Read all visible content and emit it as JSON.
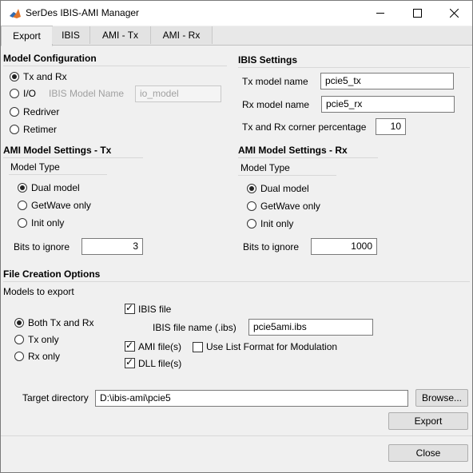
{
  "window": {
    "title": "SerDes IBIS-AMI Manager",
    "minimize_icon": "minimize-icon",
    "maximize_icon": "maximize-icon",
    "close_icon": "close-icon"
  },
  "tabs": [
    {
      "label": "Export",
      "active": true
    },
    {
      "label": "IBIS",
      "active": false
    },
    {
      "label": "AMI - Tx",
      "active": false
    },
    {
      "label": "AMI - Rx",
      "active": false
    }
  ],
  "model_config": {
    "title": "Model Configuration",
    "options": [
      {
        "label": "Tx and Rx",
        "selected": true
      },
      {
        "label": "I/O",
        "selected": false
      },
      {
        "label": "Redriver",
        "selected": false
      },
      {
        "label": "Retimer",
        "selected": false
      }
    ],
    "ibis_model_name_label": "IBIS Model Name",
    "ibis_model_name_value": "io_model"
  },
  "ibis_settings": {
    "title": "IBIS Settings",
    "tx_model_label": "Tx model name",
    "tx_model_value": "pcie5_tx",
    "rx_model_label": "Rx model name",
    "rx_model_value": "pcie5_rx",
    "corner_label": "Tx and Rx corner percentage",
    "corner_value": "10"
  },
  "ami_tx": {
    "title": "AMI Model Settings - Tx",
    "model_type_label": "Model Type",
    "options": [
      {
        "label": "Dual model",
        "selected": true
      },
      {
        "label": "GetWave only",
        "selected": false
      },
      {
        "label": "Init only",
        "selected": false
      }
    ],
    "bits_label": "Bits to ignore",
    "bits_value": "3"
  },
  "ami_rx": {
    "title": "AMI Model Settings - Rx",
    "model_type_label": "Model Type",
    "options": [
      {
        "label": "Dual model",
        "selected": true
      },
      {
        "label": "GetWave only",
        "selected": false
      },
      {
        "label": "Init only",
        "selected": false
      }
    ],
    "bits_label": "Bits to ignore",
    "bits_value": "1000"
  },
  "file_creation": {
    "title": "File Creation Options",
    "models_label": "Models to export",
    "models": [
      {
        "label": "Both Tx and Rx",
        "selected": true
      },
      {
        "label": "Tx only",
        "selected": false
      },
      {
        "label": "Rx only",
        "selected": false
      }
    ],
    "ibis_file_label": "IBIS file",
    "ibis_file_checked": true,
    "ibis_file_name_label": "IBIS file name (.ibs)",
    "ibis_file_name_value": "pcie5ami.ibs",
    "ami_files_label": "AMI file(s)",
    "ami_files_checked": true,
    "list_format_label": "Use List Format for Modulation",
    "list_format_checked": false,
    "dll_files_label": "DLL file(s)",
    "dll_files_checked": true,
    "target_dir_label": "Target directory",
    "target_dir_value": "D:\\ibis-ami\\pcie5",
    "browse_label": "Browse...",
    "export_label": "Export"
  },
  "footer": {
    "close_label": "Close"
  }
}
